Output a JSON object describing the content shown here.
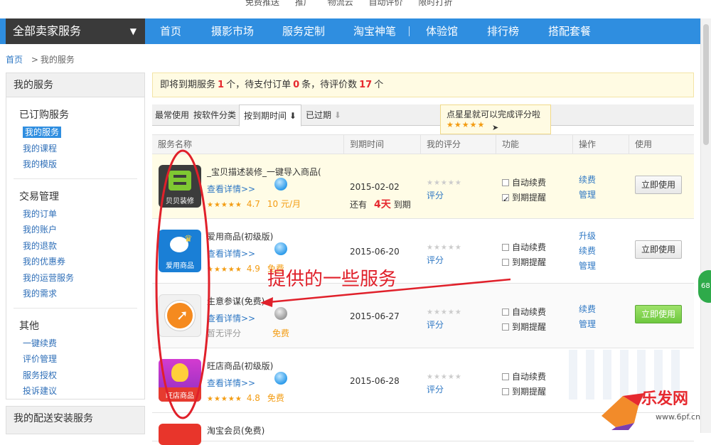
{
  "topbar": {
    "links": [
      "免费推送",
      "推广",
      "物流云",
      "自动评价",
      "限时打折"
    ]
  },
  "nav": {
    "all_sellers": "全部卖家服务",
    "items": [
      "首页",
      "摄影市场",
      "服务定制",
      "淘宝神笔",
      "体验馆",
      "排行榜",
      "搭配套餐"
    ]
  },
  "breadcrumb": {
    "home": "首页",
    "sep": ">",
    "current": "我的服务"
  },
  "sidebar": {
    "title": "我的服务",
    "groups": [
      {
        "title": "已订购服务",
        "items": [
          "我的服务",
          "我的课程",
          "我的模版"
        ]
      },
      {
        "title": "交易管理",
        "items": [
          "我的订单",
          "我的账户",
          "我的退款",
          "我的优惠券",
          "我的运营服务",
          "我的需求"
        ]
      },
      {
        "title": "其他",
        "items": [
          "一键续费",
          "评价管理",
          "服务授权",
          "投诉建议"
        ]
      }
    ],
    "second_title": "我的配送安装服务"
  },
  "notice": {
    "p1": "即将到期服务",
    "n1": "1",
    "p2": "个，待支付订单",
    "n2": "0",
    "p3": "条，待评价数",
    "n3": "17",
    "p4": "个"
  },
  "tabs": {
    "recent": "最常使用",
    "category": "按软件分类",
    "expire": "按到期时间",
    "expired": "已过期"
  },
  "tooltip": {
    "text": "点星星就可以完成评分啦",
    "stars": "★★★★★"
  },
  "table": {
    "headers": [
      "服务名称",
      "到期时间",
      "我的评分",
      "功能",
      "操作",
      "使用"
    ],
    "rows": [
      {
        "name": "_宝贝描述装修_一键导入商品(",
        "detail": "查看详情>>",
        "stars": "★★★★★",
        "score": "4.7",
        "price": "10 元/月",
        "date": "2015-02-02",
        "remain_prefix": "还有",
        "remain_days": "4天",
        "remain_suffix": "到期",
        "my_stars": "★★★★★",
        "rate_link": "评分",
        "func1": "自动续费",
        "func2": "到期提醒",
        "ops": [
          "续费",
          "管理"
        ],
        "use": "立即使用",
        "logo_label": "贝贝装修"
      },
      {
        "name": "爱用商品(初级版)",
        "detail": "查看详情>>",
        "stars": "★★★★★",
        "score": "4.9",
        "price": "免费",
        "date": "2015-06-20",
        "my_stars": "★★★★★",
        "rate_link": "评分",
        "func1": "自动续费",
        "func2": "到期提醒",
        "ops": [
          "升级",
          "续费",
          "管理"
        ],
        "use": "立即使用",
        "logo_label": "爱用商品"
      },
      {
        "name": "生意参谋(免费)",
        "detail": "查看详情>>",
        "no_rating": "暂无评分",
        "price": "免费",
        "date": "2015-06-27",
        "my_stars": "★★★★★",
        "rate_link": "评分",
        "func1": "自动续费",
        "func2": "到期提醒",
        "ops": [
          "续费",
          "管理"
        ],
        "use": "立即使用"
      },
      {
        "name": "旺店商品(初级版)",
        "detail": "查看详情>>",
        "stars": "★★★★★",
        "score": "4.8",
        "price": "免费",
        "date": "2015-06-28",
        "my_stars": "★★★★★",
        "rate_link": "评分",
        "func1": "自动续费",
        "func2": "到期提醒",
        "logo_label": "旺店商品"
      },
      {
        "name": "淘宝会员(免费)"
      }
    ]
  },
  "annotation": {
    "text": "提供的一些服务",
    "color": "#e0202a"
  },
  "side_badge": "68",
  "watermark": {
    "text": "乐发网",
    "url": "www.6pf.cn"
  },
  "colors": {
    "nav_blue": "#2f8ee0",
    "accent_red": "#e6292f",
    "star_orange": "#f39c12",
    "link_blue": "#2f78c4"
  }
}
